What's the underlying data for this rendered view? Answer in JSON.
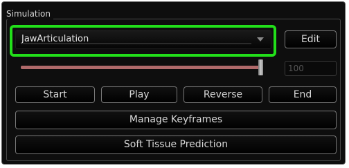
{
  "group": {
    "title": "Simulation"
  },
  "simulation_select": {
    "value": "JawArticulation"
  },
  "buttons": {
    "edit": "Edit",
    "start": "Start",
    "play": "Play",
    "reverse": "Reverse",
    "end": "End",
    "manage_keyframes": "Manage Keyframes",
    "soft_tissue_prediction": "Soft Tissue Prediction"
  },
  "slider": {
    "value_field": "100",
    "position_fraction": 1.0
  },
  "colors": {
    "highlight": "#22e01a",
    "slider_track": "#b06a6a",
    "panel_bg": "#0e0e0e"
  }
}
